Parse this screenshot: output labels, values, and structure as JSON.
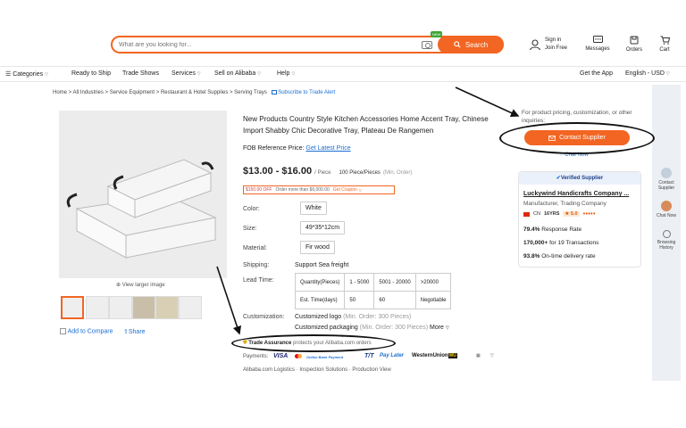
{
  "search": {
    "placeholder": "What are you looking for...",
    "button_label": "Search",
    "new_tag": "NEW"
  },
  "header": {
    "signin": "Sign in",
    "join": "Join Free",
    "messages": "Messages",
    "orders": "Orders",
    "cart": "Cart"
  },
  "nav": {
    "categories": "Categories",
    "items": [
      "Ready to Ship",
      "Trade Shows",
      "Services",
      "Sell on Alibaba",
      "Help"
    ],
    "get_app": "Get the App",
    "language": "English - USD"
  },
  "breadcrumb": [
    "Home",
    "All Industries",
    "Service Equipment",
    "Restaurant & Hotel Supplies",
    "Serving Trays"
  ],
  "subscribe": "Subscribe to Trade Alert",
  "gallery": {
    "view_larger": "View larger image",
    "add_compare": "Add to Compare",
    "share": "Share"
  },
  "product": {
    "title": "New Products Country Style Kitchen Accessories Home Accent Tray, Chinese Import Shabby Chic Decorative Tray, Plateau De Rangemen",
    "fob_label": "FOB Reference Price:",
    "fob_link": "Get Latest Price",
    "price": "$13.00 - $16.00",
    "price_unit": "/ Piece",
    "min_order": "100 Piece/Pieces",
    "min_order_note": "(Min. Order)",
    "coupon_text": "$150.00 OFF",
    "coupon_cond": "Order more than $6,000.00",
    "coupon_btn": "Get Coupon",
    "color_label": "Color:",
    "color_value": "White",
    "size_label": "Size:",
    "size_value": "49*35*12cm",
    "material_label": "Material:",
    "material_value": "Fir wood",
    "shipping_label": "Shipping:",
    "shipping_value": "Support Sea freight",
    "lead_label": "Lead Time:",
    "lead_table": {
      "row1": [
        "Quantity(Pieces)",
        "1 - 5000",
        "5001 - 20000",
        ">20000"
      ],
      "row2": [
        "Est. Time(days)",
        "50",
        "60",
        "Negotiable"
      ]
    },
    "custom_label": "Customization:",
    "custom_logo": "Customized logo",
    "custom_logo_note": "(Min. Order: 300 Pieces)",
    "custom_pack": "Customized packaging",
    "custom_pack_note": "(Min. Order: 300 Pieces)",
    "more": "More",
    "trade_assurance": "Trade Assurance",
    "trade_assurance_note": "protects your Alibaba.com orders",
    "payments_label": "Payments:",
    "payments": [
      "VISA",
      "Online Bank Payment",
      "T/T",
      "Pay Later",
      "WesternUnion",
      "WU"
    ],
    "services": [
      "Alibaba.com Logistics",
      "Inspection Solutions",
      "Production View"
    ]
  },
  "supplier": {
    "inquiry_text": "For product pricing, customization, or other inquiries:",
    "contact_btn": "Contact Supplier",
    "chat_now": "Chat Now",
    "verified": "Verified Supplier",
    "name": "Luckywind Handicrafts Company ...",
    "type": "Manufacturer, Trading Company",
    "country": "CN",
    "years": "16YRS",
    "rating": "5.0",
    "response_rate": "79.4%",
    "response_label": "Response Rate",
    "transactions": "170,000+",
    "transactions_label": "for 19 Transactions",
    "delivery": "93.8%",
    "delivery_label": "On-time delivery rate"
  },
  "sidebar": [
    "Contact Supplier",
    "Chat Now",
    "Browsing History"
  ],
  "colors": {
    "accent": "#f26522",
    "link": "#1b6ed3"
  }
}
